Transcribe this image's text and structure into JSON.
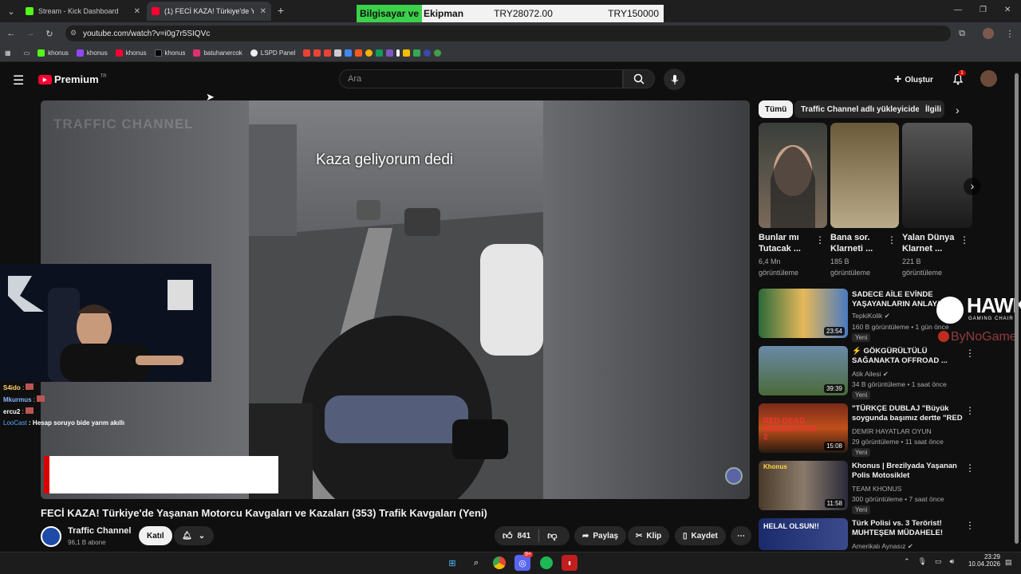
{
  "browser": {
    "tabs": [
      {
        "label": "Stream - Kick Dashboard",
        "icon": "kick-icon"
      },
      {
        "label": "(1) FECİ KAZA! Türkiye'de Yaşan",
        "icon": "youtube-icon"
      }
    ],
    "url": "youtube.com/watch?v=i0g7r5SIQVc",
    "bookmarks": [
      "khonus",
      "khonus",
      "khonus",
      "khonus",
      "batuhanercok",
      "LSPD Panel"
    ]
  },
  "price_overlay": {
    "tag": "Bilgisayar ve",
    "label": "Ekipman",
    "current": "TRY28072.00",
    "goal": "TRY150000"
  },
  "youtube": {
    "logo": "Premium",
    "logo_region": "TR",
    "search_placeholder": "Ara",
    "create_label": "Oluştur",
    "notification_count": "1"
  },
  "player": {
    "channel_watermark": "TRAFFIC CHANNEL",
    "caption": "Kaza geliyorum dedi"
  },
  "chat": [
    {
      "user": "S4ido",
      "message": ":",
      "color": "#ffd166"
    },
    {
      "user": "Mkurmus",
      "message": ":",
      "color": "#8ab4ff"
    },
    {
      "user": "ercu2",
      "message": ":",
      "color": "#ffffff"
    },
    {
      "user": "LooCast",
      "message": ": Hesap soruyo bide yarım akıllı",
      "color": "#5aa7ff"
    }
  ],
  "video": {
    "title": "FECİ KAZA! Türkiye'de Yaşanan Motorcu Kavgaları ve Kazaları (353) Trafik Kavgaları (Yeni)",
    "channel": "Traffic Channel",
    "subscribers": "96,1 B abone",
    "join_label": "Katıl",
    "likes": "841",
    "share_label": "Paylaş",
    "clip_label": "Klip",
    "save_label": "Kaydet"
  },
  "sidebar": {
    "chips": [
      "Tümü",
      "Traffic Channel adlı yükleyiciden",
      "İlgili"
    ],
    "shorts": [
      {
        "title1": "Bunlar mı",
        "title2": "Tutacak ...",
        "views": "6,4 Mn",
        "unit": "görüntüleme"
      },
      {
        "title1": "Bana sor.",
        "title2": "Klarneti ...",
        "views": "185 B",
        "unit": "görüntüleme"
      },
      {
        "title1": "Yalan Dünya",
        "title2": "Klarnet ...",
        "views": "221 B",
        "unit": "görüntüleme"
      }
    ],
    "recommendations": [
      {
        "title": "SADECE AİLE EVİNDE YAŞAYANLARIN ANLAYACAĞI",
        "channel": "TepkiKolik",
        "meta": "160 B görüntüleme • 1 gün önce",
        "badge": "Yeni",
        "duration": "23:54"
      },
      {
        "title": "⚡ GÖKGÜRÜLTÜLÜ SAĞANAKTA OFFROAD ...",
        "channel": "Atik Ailesi",
        "meta": "34 B görüntüleme • 1 saat önce",
        "badge": "Yeni",
        "duration": "39:39"
      },
      {
        "title": "\"TÜRKÇE DUBLAJ \"Büyük soygunda başımız dertte \"RED ...",
        "channel": "DEMİR HAYATLAR OYUN",
        "meta": "29 görüntüleme • 11 saat önce",
        "badge": "Yeni",
        "duration": "15:08"
      },
      {
        "title": "Khonus | Brezilyada Yaşanan Polis Motosiklet Kovalamacal...",
        "channel": "TEAM KHONUS",
        "meta": "300 görüntüleme • 7 saat önce",
        "badge": "Yeni",
        "duration": "11:58"
      },
      {
        "title": "Türk Polisi vs. 3 Terörist! MUHTEŞEM MÜDAHELE!",
        "channel": "Amerikalı Aynasız",
        "meta": "",
        "badge": "",
        "duration": ""
      }
    ],
    "sponsor": {
      "name": "HAWK",
      "tagline": "GAMING CHAIR",
      "sub": "ByNoGame"
    }
  },
  "thumb_texts": {
    "helal": "HELAL OLSUN!!",
    "khonus": "Khonus",
    "reddead": "RED DEAD REDEMPTION 2"
  },
  "taskbar": {
    "time": "23:29",
    "date": "10.04.2026",
    "discord_badge": "9+"
  }
}
